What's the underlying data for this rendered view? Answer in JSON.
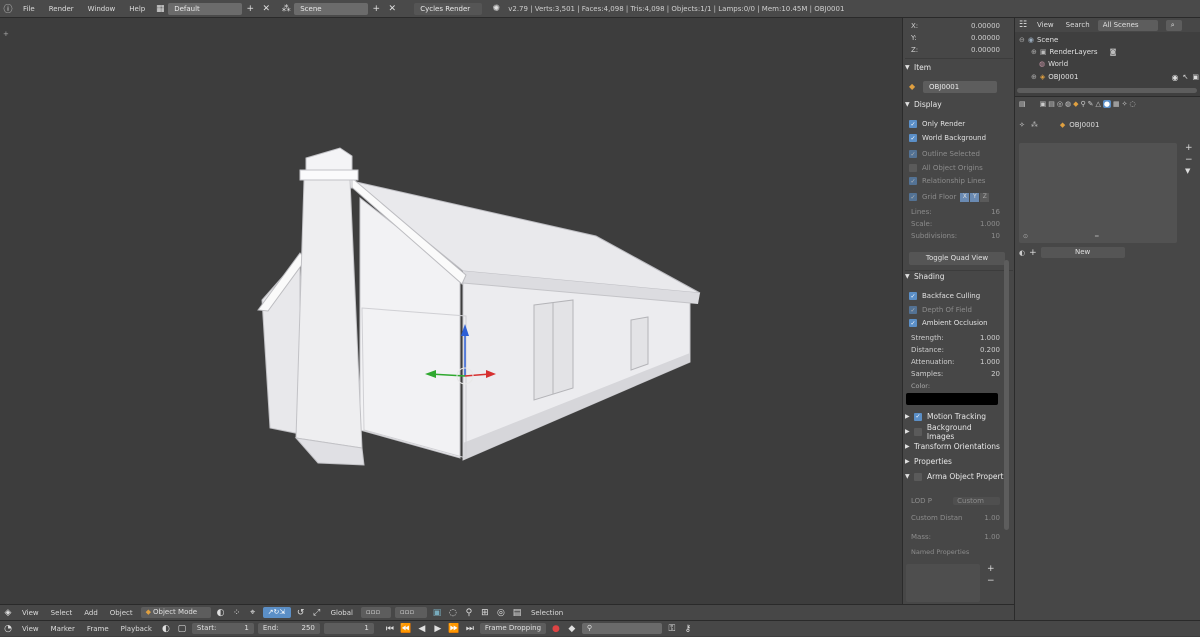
{
  "menu": {
    "file": "File",
    "render": "Render",
    "window": "Window",
    "help": "Help",
    "layout": "Default",
    "scene": "Scene",
    "engine": "Cycles Render",
    "stats": "v2.79 | Verts:3,501 | Faces:4,098 | Tris:4,098 | Objects:1/1 | Lamps:0/0 | Mem:10.45M | OBJ0001"
  },
  "npanel": {
    "x_label": "X:",
    "x_val": "0.00000",
    "y_label": "Y:",
    "y_val": "0.00000",
    "z_label": "Z:",
    "z_val": "0.00000",
    "item_title": "Item",
    "item_name": "OBJ0001",
    "display_title": "Display",
    "only_render": "Only Render",
    "world_bg": "World Background",
    "outline_sel": "Outline Selected",
    "all_origins": "All Object Origins",
    "rel_lines": "Relationship Lines",
    "grid_floor": "Grid Floor",
    "axis_x": "X",
    "axis_y": "Y",
    "axis_z": "Z",
    "lines_label": "Lines:",
    "lines_val": "16",
    "scale_label": "Scale:",
    "scale_val": "1.000",
    "subdiv_label": "Subdivisions:",
    "subdiv_val": "10",
    "toggle_quad": "Toggle Quad View",
    "shading_title": "Shading",
    "backface": "Backface Culling",
    "dof": "Depth Of Field",
    "ao": "Ambient Occlusion",
    "strength_label": "Strength:",
    "strength_val": "1.000",
    "distance_label": "Distance:",
    "distance_val": "0.200",
    "atten_label": "Attenuation:",
    "atten_val": "1.000",
    "samples_label": "Samples:",
    "samples_val": "20",
    "color_label": "Color:",
    "motion_tracking": "Motion Tracking",
    "bg_images": "Background Images",
    "transform_orient": "Transform Orientations",
    "properties": "Properties",
    "arma": "Arma Object Properti",
    "lod_label": "LOD P",
    "lod_val": "Custom",
    "custom_dist_label": "Custom Distan",
    "custom_dist_val": "1.00",
    "mass_label": "Mass:",
    "mass_val": "1.00",
    "named_props": "Named Properties"
  },
  "outliner": {
    "view": "View",
    "search": "Search",
    "scenes": "All Scenes",
    "scene": "Scene",
    "renderlayers": "RenderLayers",
    "world": "World",
    "obj": "OBJ0001"
  },
  "props": {
    "obj_name": "OBJ0001",
    "new_btn": "New"
  },
  "viewheader": {
    "view": "View",
    "select": "Select",
    "add": "Add",
    "object": "Object",
    "mode": "Object Mode",
    "orientation": "Global",
    "selection": "Selection"
  },
  "timeline": {
    "view": "View",
    "marker": "Marker",
    "frame": "Frame",
    "playback": "Playback",
    "start_label": "Start:",
    "start_val": "1",
    "end_label": "End:",
    "end_val": "250",
    "current": "1",
    "sync": "Frame Dropping"
  },
  "colors": {
    "accent": "#5b8fc7",
    "bg": "#3d3d3d",
    "panel": "#474747"
  }
}
